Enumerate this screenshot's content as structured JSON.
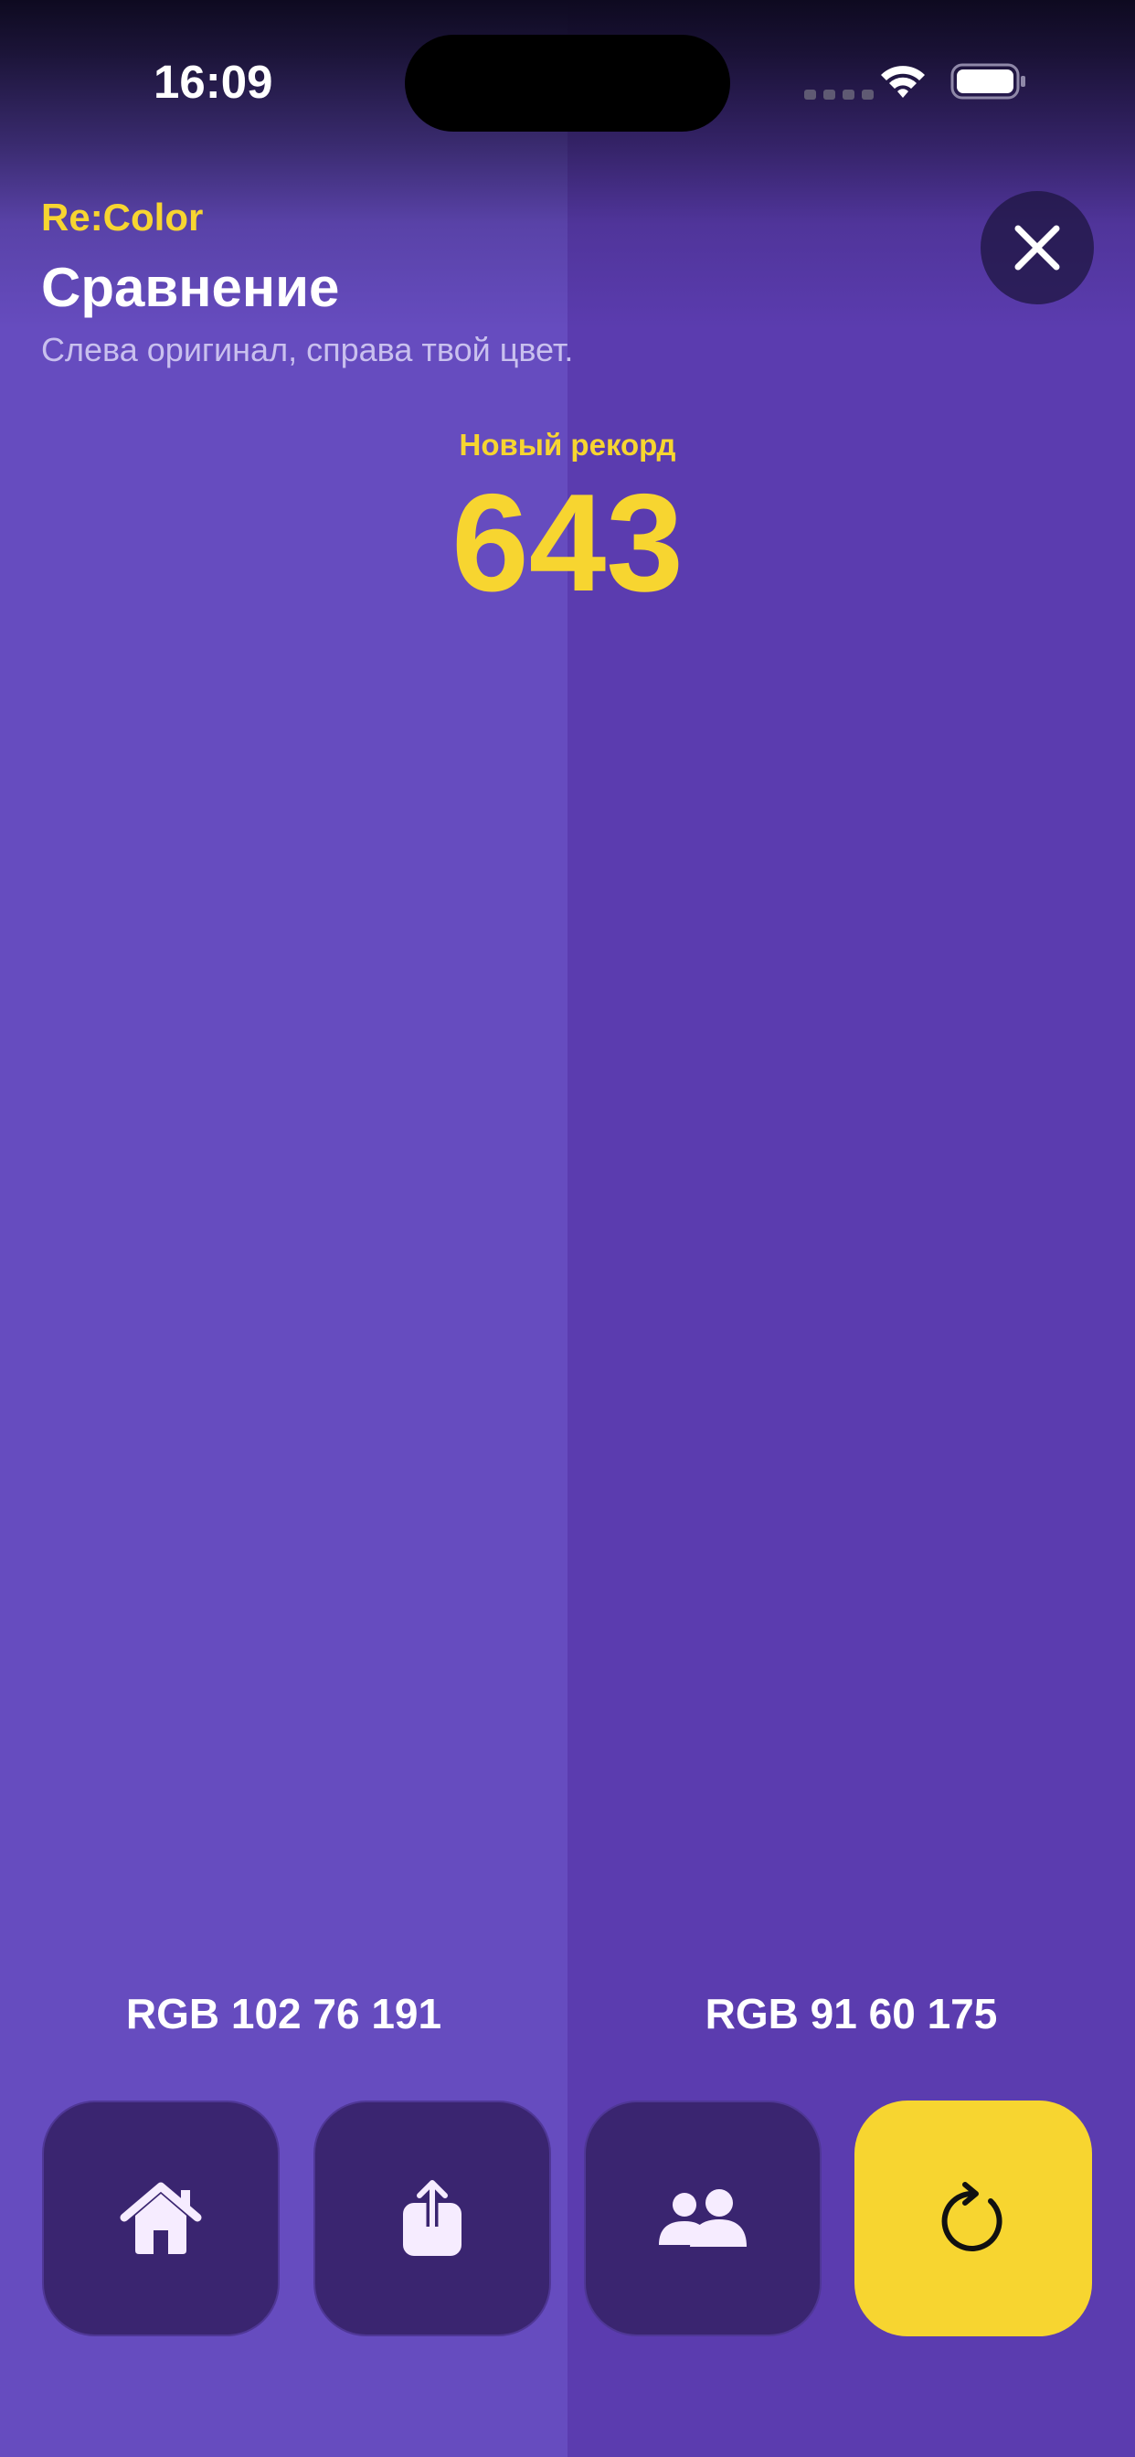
{
  "status_bar": {
    "time": "16:09"
  },
  "header": {
    "brand": "Re:Color",
    "title": "Сравнение",
    "subtitle": "Слева оригинал, справа твой цвет."
  },
  "result": {
    "record_label": "Новый рекорд",
    "score": "643"
  },
  "swatches": {
    "original": {
      "label": "RGB 102 76 191",
      "color": "#664cbf"
    },
    "user": {
      "label": "RGB 91 60 175",
      "color": "#5b3caf"
    }
  },
  "actions": [
    {
      "icon": "home-icon"
    },
    {
      "icon": "share-icon"
    },
    {
      "icon": "people-icon"
    },
    {
      "icon": "retry-icon"
    }
  ],
  "colors": {
    "accent": "#f7d530",
    "button_bg": "#3a2570"
  },
  "icons": {
    "close": "close-icon",
    "wifi": "wifi-icon",
    "battery": "battery-icon"
  }
}
